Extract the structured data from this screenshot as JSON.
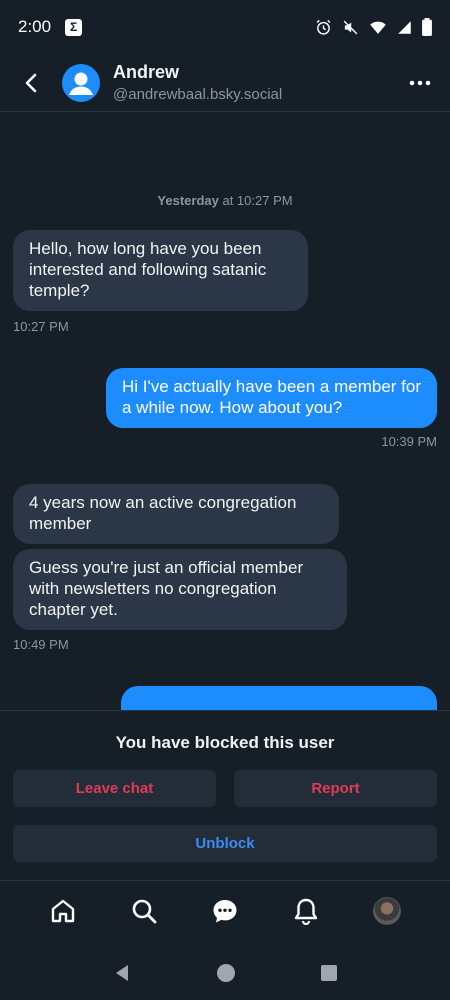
{
  "status_bar": {
    "time": "2:00",
    "app_badge": "Σ"
  },
  "header": {
    "name": "Andrew",
    "handle": "@andrewbaal.bsky.social"
  },
  "conversation": {
    "day_separator": {
      "day": "Yesterday",
      "rest": " at 10:27 PM"
    },
    "messages": [
      {
        "direction": "in",
        "text": "Hello, how long have you been interested and following satanic temple?",
        "time": "10:27 PM"
      },
      {
        "direction": "out",
        "text": "Hi I've actually have been a member for a while now. How about you?",
        "time": "10:39 PM"
      },
      {
        "direction": "in",
        "text": "4 years now an active congregation member",
        "time": ""
      },
      {
        "direction": "in",
        "text": "Guess you're just an official member with newsletters no congregation chapter yet.",
        "time": "10:49 PM"
      }
    ]
  },
  "blocked_panel": {
    "title": "You have blocked this user",
    "leave_chat_label": "Leave chat",
    "report_label": "Report",
    "unblock_label": "Unblock"
  },
  "tabs": [
    {
      "icon": "home-icon"
    },
    {
      "icon": "search-icon"
    },
    {
      "icon": "chat-icon"
    },
    {
      "icon": "bell-icon"
    },
    {
      "icon": "profile-avatar"
    }
  ],
  "colors": {
    "background": "#161e27",
    "incoming_bubble": "#2b3746",
    "outgoing_bubble": "#1d8cff",
    "danger": "#e03a55",
    "primary": "#3b8cf0"
  }
}
